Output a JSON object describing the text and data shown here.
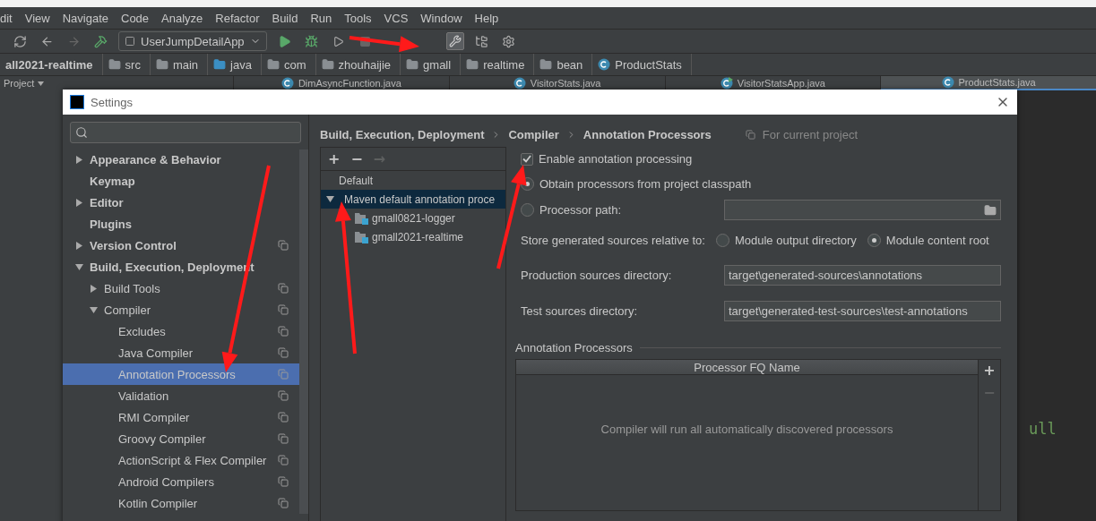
{
  "menu": [
    "dit",
    "View",
    "Navigate",
    "Code",
    "Analyze",
    "Refactor",
    "Build",
    "Run",
    "Tools",
    "VCS",
    "Window",
    "Help"
  ],
  "toolbar": {
    "run_config": "UserJumpDetailApp"
  },
  "breadcrumb": [
    {
      "label": "all2021-realtime",
      "kind": "module"
    },
    {
      "label": "src",
      "kind": "folder"
    },
    {
      "label": "main",
      "kind": "folder"
    },
    {
      "label": "java",
      "kind": "source"
    },
    {
      "label": "com",
      "kind": "package"
    },
    {
      "label": "zhouhaijie",
      "kind": "package"
    },
    {
      "label": "gmall",
      "kind": "package"
    },
    {
      "label": "realtime",
      "kind": "package"
    },
    {
      "label": "bean",
      "kind": "package"
    },
    {
      "label": "ProductStats",
      "kind": "class"
    }
  ],
  "project_tab": "Project",
  "editor_tabs": [
    {
      "label": "DimAsyncFunction.java",
      "selected": false,
      "kind": "class"
    },
    {
      "label": "VisitorStats.java",
      "selected": false,
      "kind": "class"
    },
    {
      "label": "VisitorStatsApp.java",
      "selected": false,
      "kind": "runnable"
    },
    {
      "label": "ProductStats.java",
      "selected": true,
      "kind": "class"
    }
  ],
  "editor": {
    "fragment": "ull"
  },
  "dialog": {
    "title": "Settings",
    "tree": [
      {
        "label": "Appearance & Behavior",
        "expanded": false
      },
      {
        "label": "Keymap"
      },
      {
        "label": "Editor",
        "expanded": false
      },
      {
        "label": "Plugins"
      },
      {
        "label": "Version Control",
        "expanded": false,
        "project_scoped": true
      },
      {
        "label": "Build, Execution, Deployment",
        "expanded": true,
        "children": [
          {
            "label": "Build Tools",
            "expanded": false,
            "project_scoped": true
          },
          {
            "label": "Compiler",
            "expanded": true,
            "project_scoped": true,
            "children": [
              {
                "label": "Excludes",
                "project_scoped": true,
                "selected": false
              },
              {
                "label": "Java Compiler",
                "project_scoped": true,
                "selected": false
              },
              {
                "label": "Annotation Processors",
                "project_scoped": true,
                "selected": true
              },
              {
                "label": "Validation",
                "project_scoped": true,
                "selected": false
              },
              {
                "label": "RMI Compiler",
                "project_scoped": true,
                "selected": false
              },
              {
                "label": "Groovy Compiler",
                "project_scoped": true,
                "selected": false
              },
              {
                "label": "ActionScript & Flex Compiler",
                "project_scoped": true,
                "selected": false
              },
              {
                "label": "Android Compilers",
                "project_scoped": true,
                "selected": false
              },
              {
                "label": "Kotlin Compiler",
                "project_scoped": true,
                "selected": false
              }
            ]
          }
        ]
      }
    ],
    "crumbs": [
      "Build, Execution, Deployment",
      "Compiler",
      "Annotation Processors"
    ],
    "scope_note": "For current project",
    "profile_actions": [
      {
        "label": "+",
        "disabled": false
      },
      {
        "label": "−",
        "disabled": false
      },
      {
        "label": "→",
        "disabled": true
      }
    ],
    "profiles": [
      {
        "label": "Default",
        "selected": false
      },
      {
        "label": "Maven default annotation proce",
        "selected": true,
        "expanded": true,
        "children": [
          "gmall0821-logger",
          "gmall2021-realtime"
        ]
      }
    ],
    "enable": {
      "label": "Enable annotation processing",
      "checked": true
    },
    "source_options": [
      {
        "label": "Obtain processors from project classpath",
        "selected": true
      },
      {
        "label": "Processor path:",
        "selected": false
      }
    ],
    "store": {
      "label": "Store generated sources relative to:",
      "options": [
        {
          "label": "Module output directory",
          "selected": false
        },
        {
          "label": "Module content root",
          "selected": true
        }
      ]
    },
    "directories": [
      {
        "label": "Production sources directory:",
        "value": "target\\generated-sources\\annotations"
      },
      {
        "label": "Test sources directory:",
        "value": "target\\generated-test-sources\\test-annotations"
      }
    ],
    "processors": {
      "title": "Annotation Processors",
      "column": "Processor FQ Name",
      "empty": "Compiler will run all automatically discovered processors",
      "actions": [
        {
          "label": "+",
          "disabled": false
        },
        {
          "label": "−",
          "disabled": true
        }
      ]
    }
  }
}
